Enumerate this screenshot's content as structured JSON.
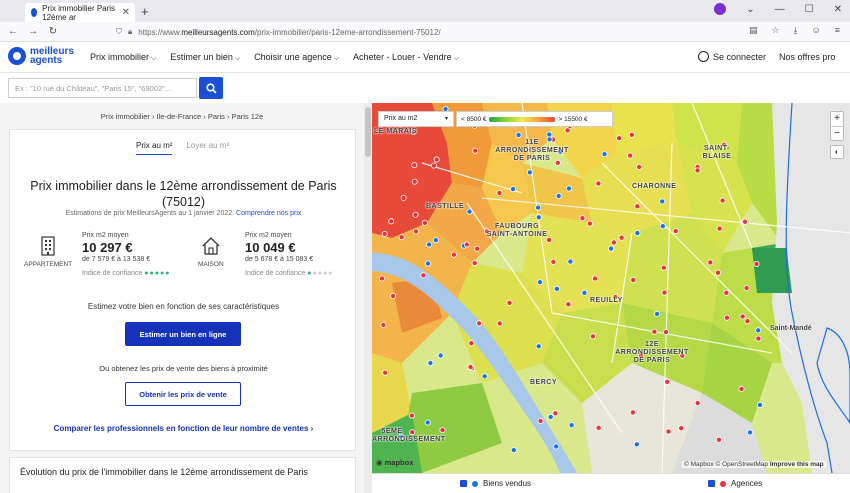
{
  "browser": {
    "tab_title": "Prix immobilier Paris 12ème ar",
    "url_prefix": "https://www.",
    "url_domain": "meilleursagents.com",
    "url_path": "/prix-immobilier/paris-12eme-arrondissement-75012/"
  },
  "header": {
    "logo_line1": "meilleurs",
    "logo_line2": "agents",
    "menu": [
      "Prix immobilier",
      "Estimer un bien",
      "Choisir une agence",
      "Acheter - Louer - Vendre"
    ],
    "connect": "Se connecter",
    "offers": "Nos offres pro"
  },
  "search": {
    "placeholder": "Ex : \"10 rue du Château\", \"Paris 15\", \"69002\"..."
  },
  "breadcrumb": [
    "Prix immobilier",
    "Ile-de-France",
    "Paris",
    "Paris 12e"
  ],
  "summary": {
    "tab_active": "Prix au m²",
    "tab_inactive": "Loyer au m²",
    "title": "Prix immobilier dans le 12ème arrondissement de Paris (75012)",
    "estimation_note": "Estimations de prix MeilleursAgents au 1 janvier 2022.",
    "estimation_link": "Comprendre nos prix",
    "appartement": {
      "type": "APPARTEMENT",
      "label": "Prix m2 moyen",
      "value": "10 297 €",
      "range": "de 7 579 € à 13 538 €",
      "confidence_label": "Indice de confiance",
      "confidence": 5
    },
    "maison": {
      "type": "MAISON",
      "label": "Prix m2 moyen",
      "value": "10 049 €",
      "range": "de 5 678 € à 15 083 €",
      "confidence_label": "Indice de confiance",
      "confidence": 1
    },
    "estimate_text": "Estimez votre bien en fonction de ses caractéristiques",
    "estimate_button": "Estimer un bien en ligne",
    "sales_text": "Ou obtenez les prix de vente des biens à proximité",
    "sales_button": "Obtenir les prix de vente",
    "compare_link": "Comparer les professionnels en fonction de leur nombre de ventes"
  },
  "evolution_title": "Évolution du prix de l'immobilier dans le 12ème arrondissement de Paris",
  "map": {
    "select_label": "Prix au m2",
    "legend_low": "< 8500 €",
    "legend_high": "> 15500 €",
    "labels": {
      "onzieme": "11E ARRONDISSEMENT DE PARIS",
      "bastille": "BASTILLE",
      "faubourg": "FAUBOURG SAINT-ANTOINE",
      "charonne": "CHARONNE",
      "saint_blaise": "SAINT-BLAISE",
      "reuilly": "REUILLY",
      "douzieme": "12E ARRONDISSEMENT DE PARIS",
      "bercy": "BERCY",
      "saint_mande": "Saint-Mandé",
      "marais": "LE MARAIS",
      "cinquieme": "5EME ARRONDISSEMENT"
    },
    "mapbox": "mapbox",
    "attribution": "© Mapbox © OpenStreetMap",
    "improve": "Improve this map"
  },
  "bottom_legend": {
    "biens": "Biens vendus",
    "agences": "Agences",
    "biens_color": "#1a73e8",
    "agences_color": "#e8333a"
  }
}
